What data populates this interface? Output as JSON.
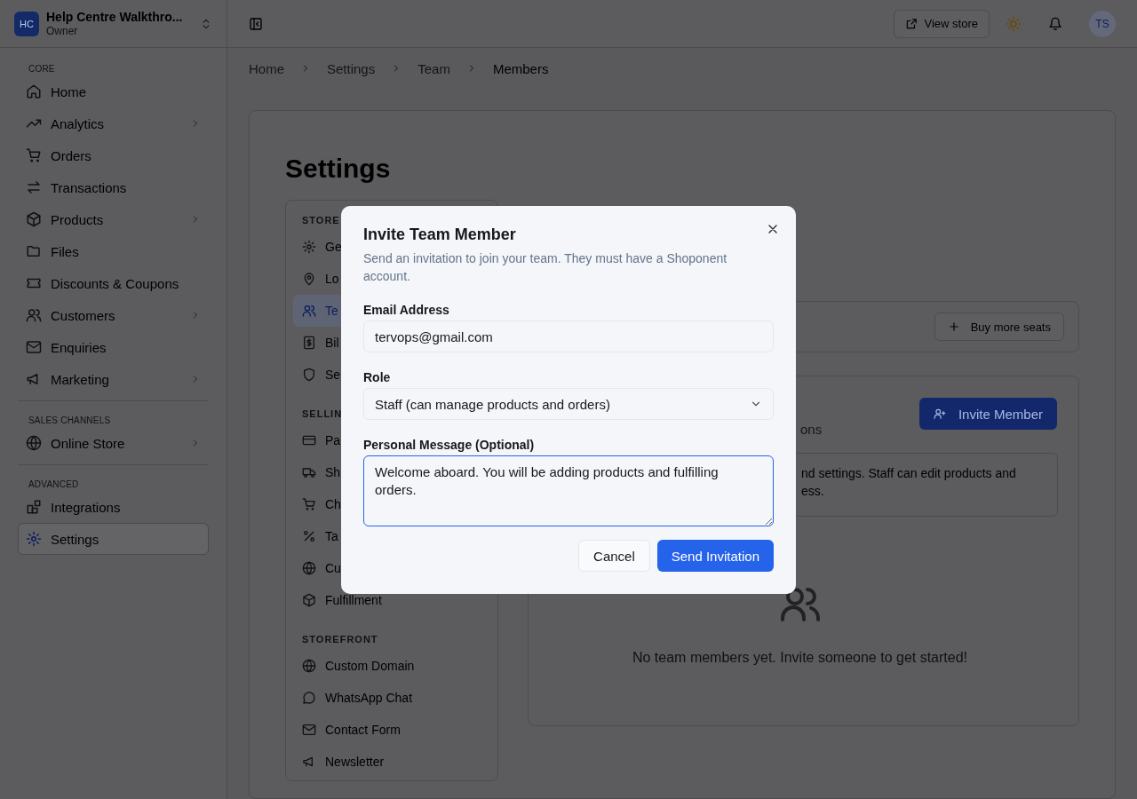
{
  "brand": {
    "initials": "HC",
    "name": "Help Centre Walkthro...",
    "role": "Owner"
  },
  "sidebar": {
    "sections": [
      {
        "title": "CORE",
        "items": [
          {
            "label": "Home",
            "chevron": false,
            "selected": false
          },
          {
            "label": "Analytics",
            "chevron": true,
            "selected": false
          },
          {
            "label": "Orders",
            "chevron": false,
            "selected": false
          },
          {
            "label": "Transactions",
            "chevron": false,
            "selected": false
          },
          {
            "label": "Products",
            "chevron": true,
            "selected": false
          },
          {
            "label": "Files",
            "chevron": false,
            "selected": false
          },
          {
            "label": "Discounts & Coupons",
            "chevron": false,
            "selected": false
          },
          {
            "label": "Customers",
            "chevron": true,
            "selected": false
          },
          {
            "label": "Enquiries",
            "chevron": false,
            "selected": false
          },
          {
            "label": "Marketing",
            "chevron": true,
            "selected": false
          }
        ]
      },
      {
        "title": "SALES CHANNELS",
        "items": [
          {
            "label": "Online Store",
            "chevron": true,
            "selected": false
          }
        ]
      },
      {
        "title": "ADVANCED",
        "items": [
          {
            "label": "Integrations",
            "chevron": false,
            "selected": false
          },
          {
            "label": "Settings",
            "chevron": false,
            "selected": true
          }
        ]
      }
    ]
  },
  "topbar": {
    "view_store": "View store",
    "avatar": "TS"
  },
  "breadcrumb": [
    {
      "label": "Home",
      "current": false
    },
    {
      "label": "Settings",
      "current": false
    },
    {
      "label": "Team",
      "current": false
    },
    {
      "label": "Members",
      "current": true
    }
  ],
  "page_title": "Settings",
  "settings_nav": [
    {
      "title": "STORE",
      "items": [
        {
          "label": "Ge",
          "selected": false
        },
        {
          "label": "Lo",
          "selected": false
        },
        {
          "label": "Te",
          "selected": true
        },
        {
          "label": "Bil",
          "selected": false
        },
        {
          "label": "Se",
          "selected": false
        }
      ]
    },
    {
      "title": "SELLIN",
      "items": [
        {
          "label": "Pa",
          "selected": false
        },
        {
          "label": "Sh",
          "selected": false
        },
        {
          "label": "Ch",
          "selected": false
        },
        {
          "label": "Ta",
          "selected": false
        },
        {
          "label": "Cu",
          "selected": false
        },
        {
          "label": "Fulfillment",
          "selected": false
        }
      ]
    },
    {
      "title": "STOREFRONT",
      "items": [
        {
          "label": "Custom Domain",
          "selected": false
        },
        {
          "label": "WhatsApp Chat",
          "selected": false
        },
        {
          "label": "Contact Form",
          "selected": false
        },
        {
          "label": "Newsletter",
          "selected": false
        }
      ]
    }
  ],
  "seats": {
    "button": "Buy more seats"
  },
  "members": {
    "subtitle_fragment": "ons",
    "invite_button": "Invite Member",
    "info_lines": [
      "nd settings. Staff can edit products and",
      "ess."
    ],
    "empty_text": "No team members yet. Invite someone to get started!"
  },
  "modal": {
    "title": "Invite Team Member",
    "description": "Send an invitation to join your team. They must have a Shoponent account.",
    "email_label": "Email Address",
    "email_value": "tervops@gmail.com",
    "role_label": "Role",
    "role_value": "Staff (can manage products and orders)",
    "message_label": "Personal Message (Optional)",
    "message_value": "Welcome aboard. You will be adding products and fulfilling orders.",
    "message_focused": true,
    "cancel": "Cancel",
    "submit": "Send Invitation"
  }
}
